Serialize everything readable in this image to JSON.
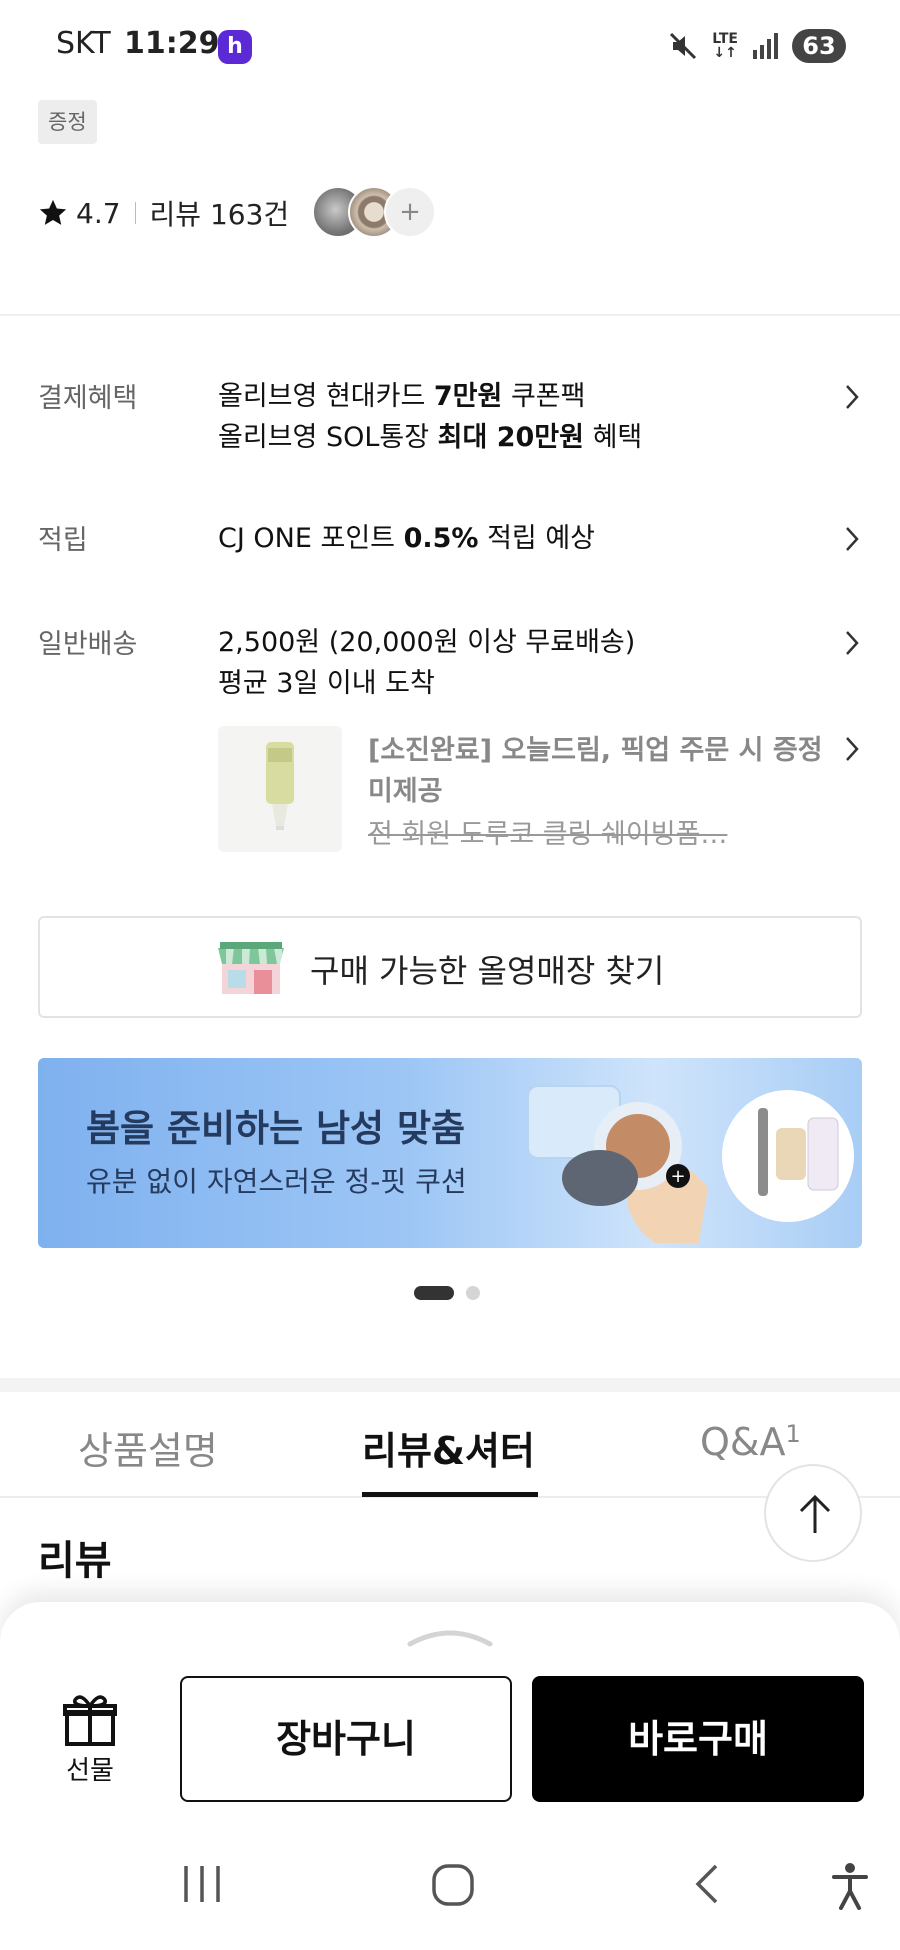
{
  "status_bar": {
    "carrier": "SKT",
    "time": "11:29",
    "app_icon_letter": "h",
    "network": "LTE",
    "battery": "63"
  },
  "product": {
    "gift_tag": "증정",
    "rating": "4.7",
    "review_count": "리뷰 163건",
    "more_thumbs": "+"
  },
  "benefits": {
    "payment": {
      "label": "결제혜택",
      "line1_pre": "올리브영 현대카드 ",
      "line1_bold": "7만원",
      "line1_post": " 쿠폰팩",
      "line2_pre": "올리브영 SOL통장 ",
      "line2_bold": "최대 20만원",
      "line2_post": " 혜택"
    },
    "points": {
      "label": "적립",
      "pre": "CJ ONE 포인트 ",
      "bold": "0.5%",
      "post": " 적립 예상"
    },
    "shipping": {
      "label": "일반배송",
      "line1": "2,500원 (20,000원 이상 무료배송)",
      "line2": "평균 3일 이내 도착"
    },
    "promo": {
      "title": "[소진완료] 오늘드림, 픽업 주문 시 증정 미제공",
      "subtitle": "전 회원 도루코 클링 쉐이빙폼…"
    }
  },
  "store_finder": {
    "label": "구매 가능한 올영매장 찾기"
  },
  "banner": {
    "title": "봄을 준비하는 남성 맞춤",
    "subtitle": "유분 없이 자연스러운 정-핏 쿠션",
    "colors": {
      "start": "#7fb1ef",
      "end": "#cfe4fb"
    }
  },
  "tabs": [
    {
      "label": "상품설명"
    },
    {
      "label": "리뷰&셔터"
    },
    {
      "label": "Q&A",
      "count": "1"
    }
  ],
  "review_section": {
    "heading": "리뷰"
  },
  "bottom_bar": {
    "gift_label": "선물",
    "cart_label": "장바구니",
    "buy_label": "바로구매"
  },
  "nav_bar": {
    "recents_icon": "recents-icon",
    "home_icon": "home-icon",
    "back_icon": "back-icon",
    "accessibility_icon": "accessibility-icon"
  }
}
